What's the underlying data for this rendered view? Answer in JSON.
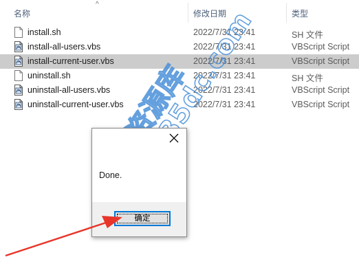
{
  "header": {
    "name": "名称",
    "date": "修改日期",
    "type": "类型"
  },
  "files": [
    {
      "name": "install.sh",
      "date": "2022/7/31 23:41",
      "type": "SH 文件",
      "icon": "document-icon"
    },
    {
      "name": "install-all-users.vbs",
      "date": "2022/7/31 23:41",
      "type": "VBScript Script",
      "icon": "vbscript-icon"
    },
    {
      "name": "install-current-user.vbs",
      "date": "2022/7/31 23:41",
      "type": "VBScript Script",
      "icon": "vbscript-icon",
      "selected": true
    },
    {
      "name": "uninstall.sh",
      "date": "2022/7/31 23:41",
      "type": "SH 文件",
      "icon": "document-icon"
    },
    {
      "name": "uninstall-all-users.vbs",
      "date": "2022/7/31 23:41",
      "type": "VBScript Script",
      "icon": "vbscript-icon"
    },
    {
      "name": "uninstall-current-user.vbs",
      "date": "2022/7/31 23:41",
      "type": "VBScript Script",
      "icon": "vbscript-icon"
    }
  ],
  "dialog": {
    "message": "Done.",
    "ok_label": "确定",
    "close_icon": "close-icon"
  },
  "watermark": {
    "line1": "资源库",
    "line2": "hao.35dc.com",
    "color": "#4a90d9"
  },
  "annotation": {
    "arrow_color": "#e8352a"
  },
  "colors": {
    "selected_row": "#cccccc",
    "focus_border": "#0078d7"
  }
}
